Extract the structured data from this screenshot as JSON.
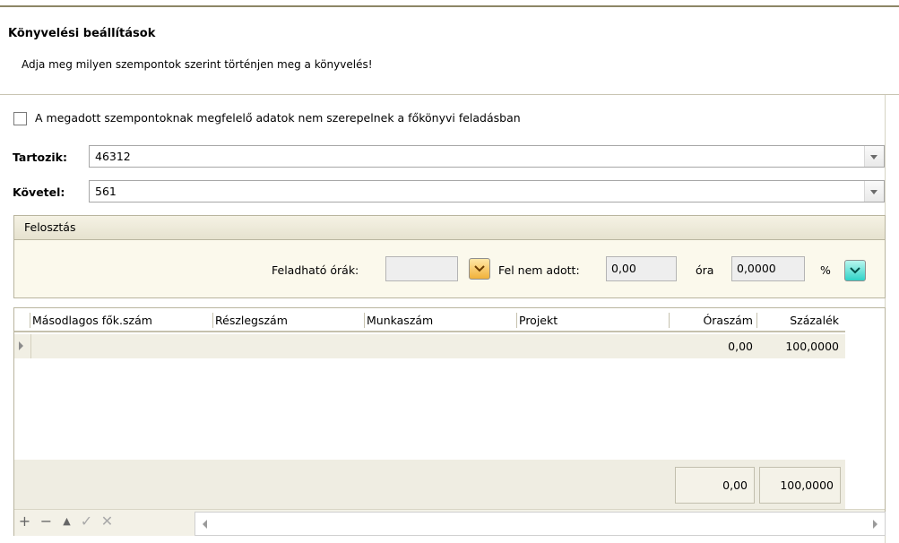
{
  "header": {
    "title": "Könyvelési beállítások",
    "subtitle": "Adja meg milyen szempontok szerint történjen meg a könyvelés!"
  },
  "exclude_checkbox": {
    "checked": false,
    "label": "A megadott szempontoknak megfelelő adatok nem szerepelnek a főkönyvi feladásban"
  },
  "tartozik": {
    "label": "Tartozik:",
    "value": "46312"
  },
  "kovetel": {
    "label": "Követel:",
    "value": "561"
  },
  "felosztas": {
    "title": "Felosztás",
    "feladhato_label": "Feladható órák:",
    "feladhato_value": "",
    "fel_nem_adott_label": "Fel nem adott:",
    "fel_nem_adott_value": "0,00",
    "ora_label": "óra",
    "percent_value": "0,0000",
    "percent_label": "%"
  },
  "grid": {
    "columns": [
      "Másodlagos fők.szám",
      "Részlegszám",
      "Munkaszám",
      "Projekt",
      "Óraszám",
      "Százalék"
    ],
    "rows": [
      {
        "masodlagos": "",
        "reszleg": "",
        "munka": "",
        "projekt": "",
        "oraszam": "0,00",
        "szazalek": "100,0000"
      }
    ],
    "totals": {
      "oraszam": "0,00",
      "szazalek": "100,0000"
    }
  },
  "toolbar": {
    "add_icon": "plus-icon",
    "remove_icon": "minus-icon",
    "up_icon": "triangle-up-icon",
    "confirm_icon": "check-icon",
    "cancel_icon": "x-icon"
  },
  "colors": {
    "panel_bg": "#fbf9ec",
    "header_line": "#8d8666",
    "orange_button": "#f1b13a",
    "teal_button": "#2fd3c8"
  }
}
